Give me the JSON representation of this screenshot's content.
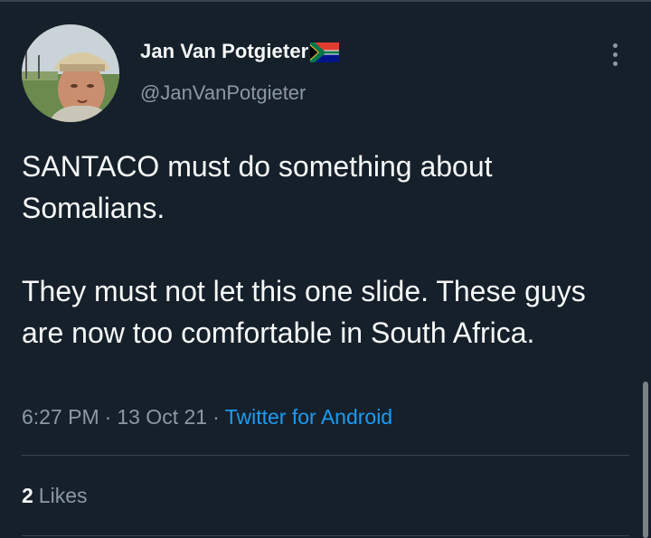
{
  "tweet": {
    "author": {
      "display_name": "Jan Van Potgieter",
      "handle": "@JanVanPotgieter",
      "flag_icon": "south-africa-flag-icon",
      "avatar_icon": "profile-photo"
    },
    "more_icon": "more-vertical-icon",
    "text": "SANTACO must do something about Somalians.\n\nThey must not let this one slide. These guys are now too comfortable in South Africa.",
    "meta": {
      "time": "6:27 PM",
      "separator": "·",
      "date": "13 Oct 21",
      "source": "Twitter for Android"
    },
    "stats": {
      "likes_count": "2",
      "likes_label": "Likes"
    }
  },
  "colors": {
    "background": "#15202b",
    "text_primary": "#f7f9f9",
    "text_secondary": "#8b98a5",
    "link": "#1d9bf0",
    "divider": "#38444d"
  }
}
